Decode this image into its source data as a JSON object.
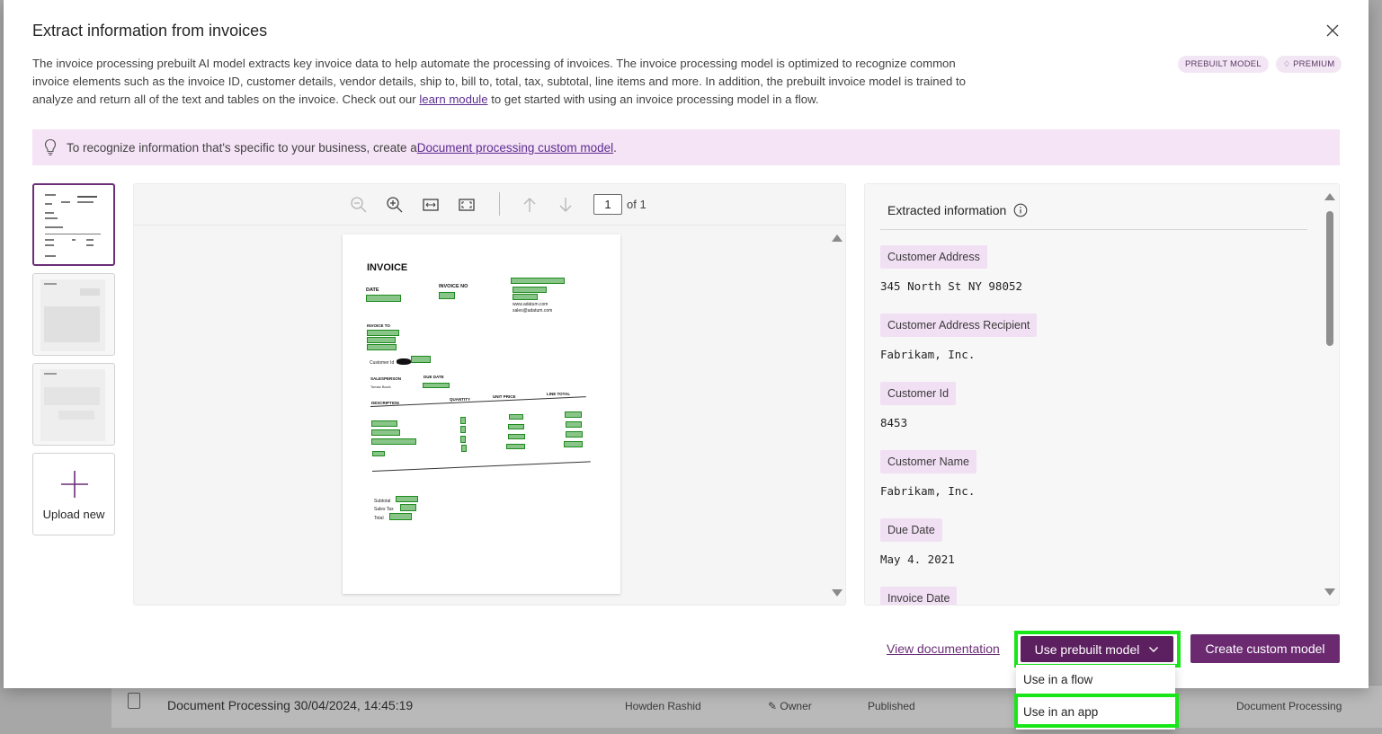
{
  "modal": {
    "title": "Extract information from invoices",
    "description_part1": "The invoice processing prebuilt AI model extracts key invoice data to help automate the processing of invoices. The invoice processing model is optimized to recognize common invoice elements such as the invoice ID, customer details, vendor details, ship to, bill to, total, tax, subtotal, line items and more. In addition, the prebuilt invoice model is trained to analyze and return all of the text and tables on the invoice. Check out our ",
    "description_link": "learn module",
    "description_part2": " to get started with using an invoice processing model in a flow.",
    "badges": {
      "prebuilt": "PREBUILT MODEL",
      "premium": "PREMIUM"
    },
    "info_bar": {
      "text": "To recognize information that's specific to your business, create a ",
      "link": "Document processing custom model",
      "suffix": "."
    }
  },
  "thumbnails": {
    "upload_label": "Upload new"
  },
  "viewer": {
    "page_number": "1",
    "page_total": "of 1",
    "document": {
      "title": "INVOICE",
      "date_label": "DATE",
      "invoice_no_label": "INVOICE NO",
      "invoice_to_label": "INVOICE TO",
      "customer_id_label": "Customer Id",
      "salesperson_label": "SALESPERSON",
      "salesperson_name": "Tomaz Bozic",
      "due_date_label": "DUE DATE",
      "description_label": "DESCRIPTION",
      "quantity_label": "QUANTITY",
      "unit_price_label": "UNIT PRICE",
      "line_total_label": "LINE TOTAL",
      "subtotal_label": "Subtotal",
      "sales_tax_label": "Sales Tax",
      "total_label": "Total",
      "website": "www.adatum.com",
      "email": "sales@adatum.com"
    }
  },
  "extracted": {
    "header": "Extracted information",
    "fields": [
      {
        "label": "Customer Address",
        "value": "345 North St NY 98052"
      },
      {
        "label": "Customer Address Recipient",
        "value": "Fabrikam, Inc."
      },
      {
        "label": "Customer Id",
        "value": "8453"
      },
      {
        "label": "Customer Name",
        "value": "Fabrikam, Inc."
      },
      {
        "label": "Due Date",
        "value": "May 4. 2021"
      },
      {
        "label": "Invoice Date",
        "value": ""
      }
    ]
  },
  "footer": {
    "view_documentation": "View documentation",
    "use_prebuilt": "Use prebuilt model",
    "create_custom": "Create custom model",
    "menu": {
      "flow": "Use in a flow",
      "app": "Use in an app"
    }
  },
  "background_row": {
    "title": "Document Processing 30/04/2024, 14:45:19",
    "owner_name": "Howden Rashid",
    "role": "Owner",
    "status": "Published",
    "type": "Document Processing"
  },
  "colors": {
    "accent": "#5c1f5f",
    "link": "#5c2d91",
    "highlight": "#19e619",
    "info_bar": "#f5e3f6"
  }
}
